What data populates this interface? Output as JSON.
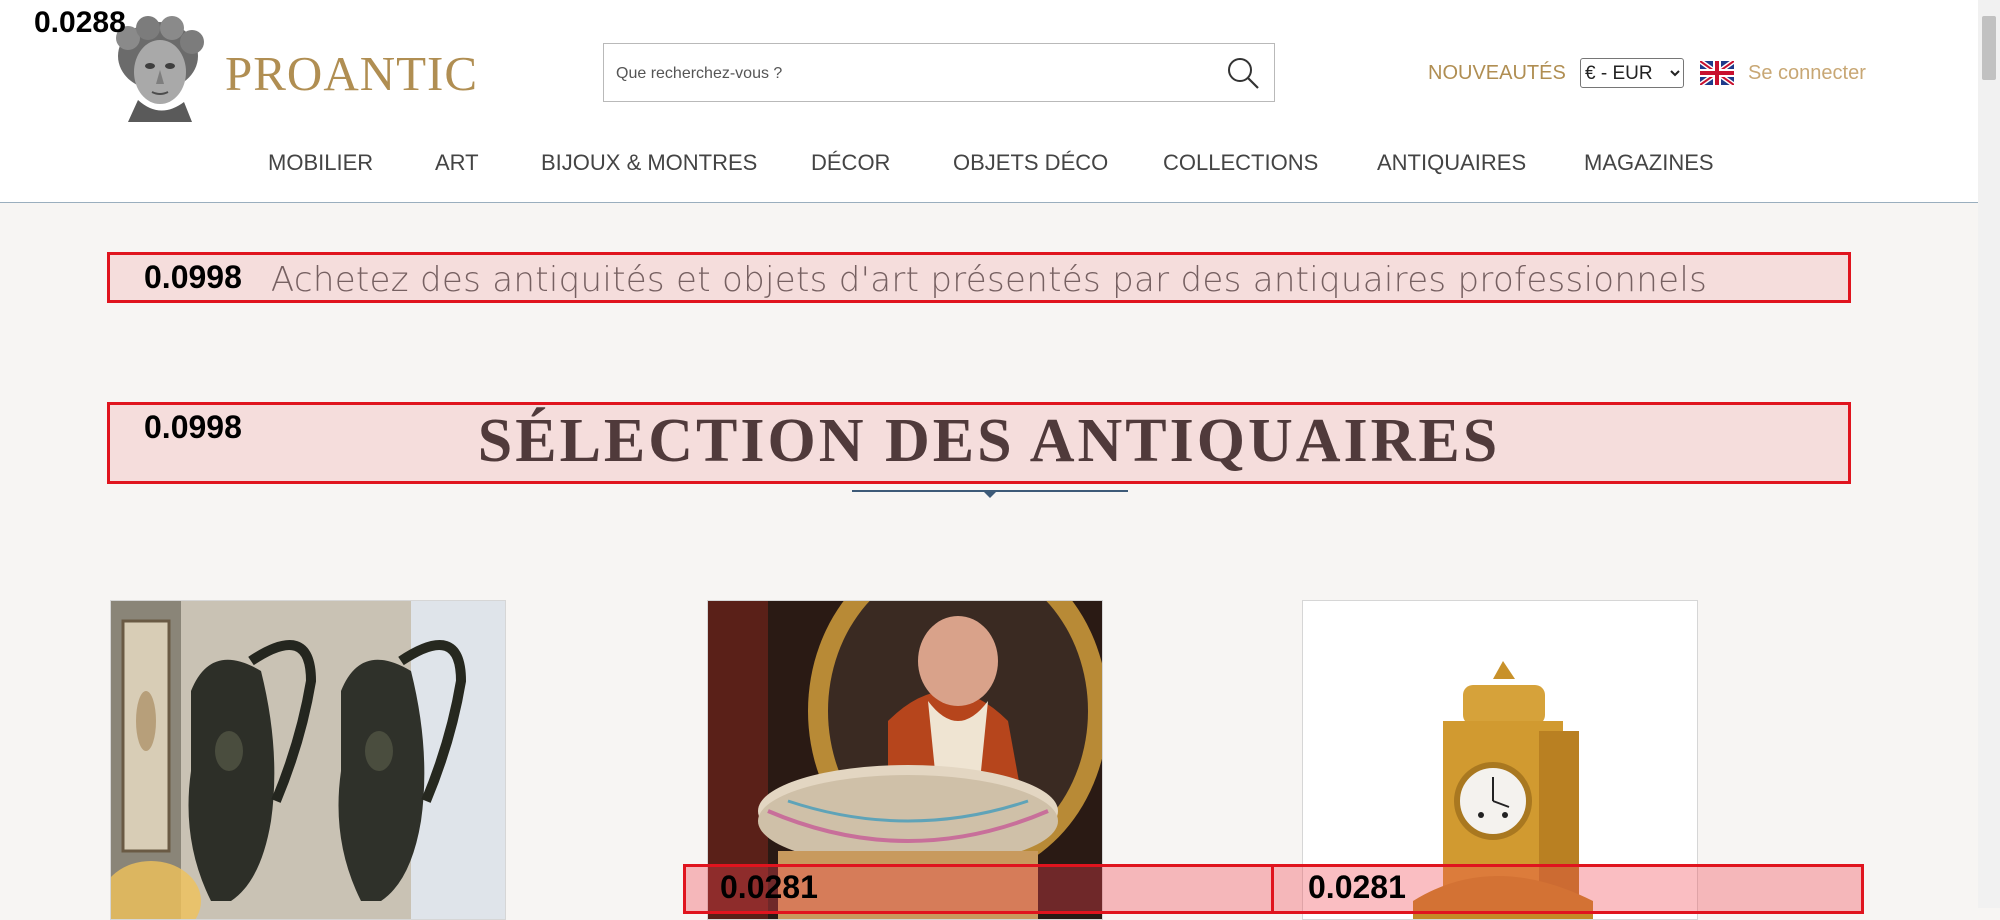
{
  "score_top": "0.0288",
  "brand": {
    "name": "PROANTIC"
  },
  "search": {
    "placeholder": "Que recherchez-vous ?"
  },
  "header": {
    "new_label": "NOUVEAUTÉS",
    "currency": "€ - EUR",
    "login_label": "Se connecter"
  },
  "nav": {
    "items": [
      {
        "label": "MOBILIER"
      },
      {
        "label": "ART"
      },
      {
        "label": "BIJOUX & MONTRES"
      },
      {
        "label": "DÉCOR"
      },
      {
        "label": "OBJETS DÉCO"
      },
      {
        "label": "COLLECTIONS"
      },
      {
        "label": "ANTIQUAIRES"
      },
      {
        "label": "MAGAZINES"
      }
    ]
  },
  "tagline": "Achetez des antiquités et objets d'art présentés par des antiquaires professionnels",
  "section_title": "SÉLECTION DES ANTIQUAIRES",
  "overlays": {
    "tagline_score": "0.0998",
    "title_score": "0.0998",
    "card2_score": "0.0281",
    "card3_score": "0.0281"
  },
  "icons": {
    "search": "search-icon",
    "flag": "uk-flag-icon",
    "logo": "logo-bust-icon"
  }
}
